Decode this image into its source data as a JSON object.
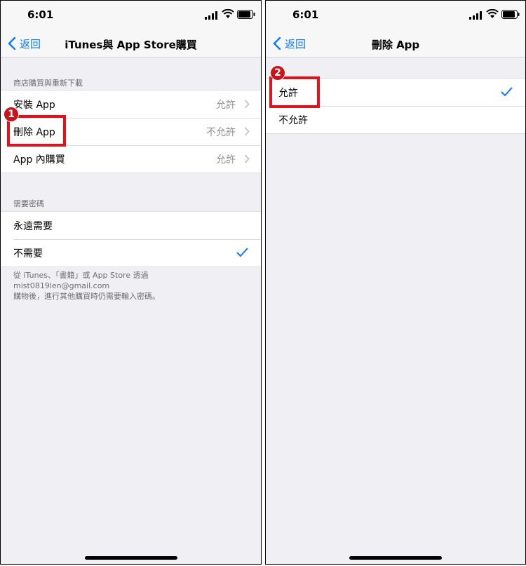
{
  "left_screen": {
    "status_time": "6:01",
    "back_label": "返回",
    "title": "iTunes與 App Store購買",
    "section1_header": "商店購買與重新下載",
    "section1_rows": [
      {
        "label": "安裝 App",
        "value": "允許"
      },
      {
        "label": "刪除 App",
        "value": "不允許"
      },
      {
        "label": "App 內購買",
        "value": "允許"
      }
    ],
    "section2_header": "需要密碼",
    "section2_rows": [
      {
        "label": "永遠需要"
      },
      {
        "label": "不需要"
      }
    ],
    "footer_line1": "從 iTunes、「書籍」或 App Store 透過 mist0819len@gmail.com",
    "footer_line2": "購物後，進行其他購買時仍需要輸入密碼。",
    "annotation_number": "1"
  },
  "right_screen": {
    "status_time": "6:01",
    "back_label": "返回",
    "title": "刪除 App",
    "rows": [
      {
        "label": "允許"
      },
      {
        "label": "不允許"
      }
    ],
    "annotation_number": "2"
  },
  "colors": {
    "accent": "#0a7aff",
    "highlight": "#e0131c",
    "background": "#efeff4"
  },
  "selected": {
    "password_option": "不需要",
    "delete_app_option": "允許"
  }
}
